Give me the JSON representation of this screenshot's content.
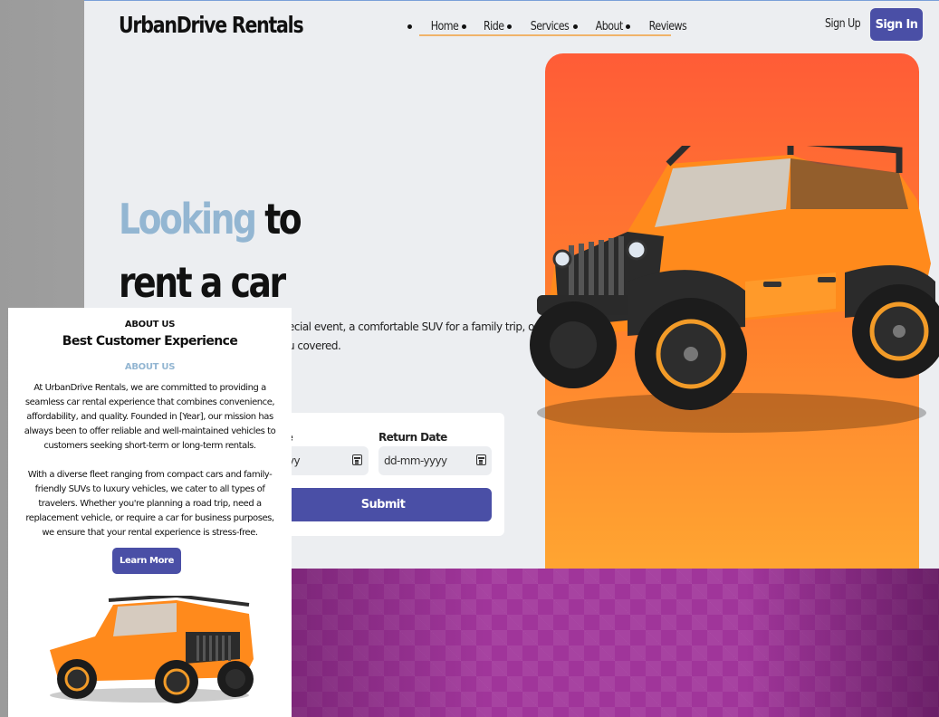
{
  "header": {
    "brand": "UrbanDrive Rentals",
    "nav": [
      "Home",
      "Ride",
      "Services",
      "About",
      "Reviews"
    ],
    "signup": "Sign Up",
    "signin": "Sign In"
  },
  "hero": {
    "accent_word": "Looking",
    "rest_line1": "to",
    "line2": "rent a car",
    "description": "ecial event, a comfortable SUV for a family trip, or a budget-\nu covered."
  },
  "form": {
    "pickup_label": "ate",
    "pickup_value": "yyyy",
    "return_label": "Return Date",
    "return_value": "dd-mm-yyyy",
    "submit": "Submit"
  },
  "about": {
    "kicker": "ABOUT US",
    "title": "Best Customer Experience",
    "sub": "ABOUT US",
    "para1": "At UrbanDrive Rentals, we are committed to providing a seamless car rental experience that combines convenience, affordability, and quality. Founded in [Year], our mission has always been to offer reliable and well-maintained vehicles to customers seeking short-term or long-term rentals.",
    "para2": "With a diverse fleet ranging from compact cars and family-friendly SUVs to luxury vehicles, we cater to all types of travelers. Whether you're planning a road trip, need a replacement vehicle, or require a car for business purposes, we ensure that your rental experience is stress-free.",
    "button": "Learn More"
  },
  "colors": {
    "primary": "#4a4fa6",
    "accent_blue": "#93b6d2",
    "orange_top": "#ff5c37",
    "orange_bottom": "#ffa531",
    "purple": "#a0359a"
  }
}
